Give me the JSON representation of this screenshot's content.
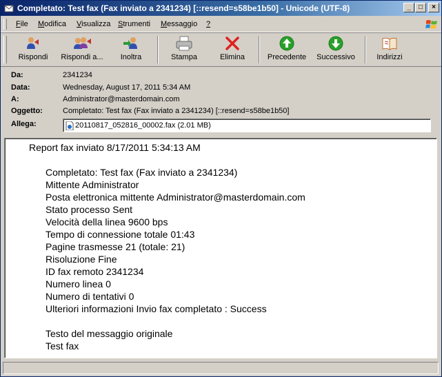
{
  "window": {
    "title": "Completato: Test fax (Fax inviato a 2341234) [::resend=s58be1b50] - Unicode (UTF-8)",
    "minimize": "_",
    "maximize": "□",
    "close": "×"
  },
  "menu": [
    {
      "first": "F",
      "rest": "ile"
    },
    {
      "first": "M",
      "rest": "odifica"
    },
    {
      "first": "V",
      "rest": "isualizza"
    },
    {
      "first": "S",
      "rest": "trumenti"
    },
    {
      "first": "M",
      "rest": "essaggio"
    },
    {
      "first": "?",
      "rest": ""
    }
  ],
  "toolbar": {
    "reply": "Rispondi",
    "reply_all": "Rispondi a...",
    "forward": "Inoltra",
    "print": "Stampa",
    "delete": "Elimina",
    "previous": "Precedente",
    "next": "Successivo",
    "addresses": "Indirizzi"
  },
  "header": {
    "from_label": "Da:",
    "from": "2341234",
    "date_label": "Data:",
    "date": "Wednesday, August 17, 2011 5:34 AM",
    "to_label": "A:",
    "to": "Administrator@masterdomain.com",
    "subject_label": "Oggetto:",
    "subject": "Completato: Test fax (Fax inviato a 2341234) [::resend=s58be1b50]",
    "attach_label": "Allega:",
    "attachment": "20110817_052816_00002.fax (2.01 MB)"
  },
  "body": {
    "heading": "Report fax inviato 8/17/2011 5:34:13 AM",
    "lines": [
      "Completato: Test fax (Fax inviato a 2341234)",
      "Mittente Administrator",
      "Posta elettronica mittente Administrator@masterdomain.com",
      "Stato processo Sent",
      "Velocità della linea 9600 bps",
      "Tempo di connessione totale 01:43",
      "Pagine trasmesse 21 (totale: 21)",
      "Risoluzione Fine",
      "ID fax remoto 2341234",
      "Numero linea 0",
      "Numero di tentativi 0",
      "Ulteriori informazioni Invio fax completato : Success"
    ],
    "original_label": "Testo del messaggio originale",
    "original_text": "Test fax"
  },
  "colors": {
    "title_bar": "#0a246a",
    "window_bg": "#d4d0c8",
    "delete_red": "#e02020",
    "nav_green": "#2aa02a"
  },
  "icons": [
    "envelope-icon",
    "reply-icon",
    "reply-all-icon",
    "forward-icon",
    "printer-icon",
    "delete-x-icon",
    "up-arrow-icon",
    "down-arrow-icon",
    "address-book-icon",
    "fax-file-icon",
    "windows-logo-icon"
  ]
}
